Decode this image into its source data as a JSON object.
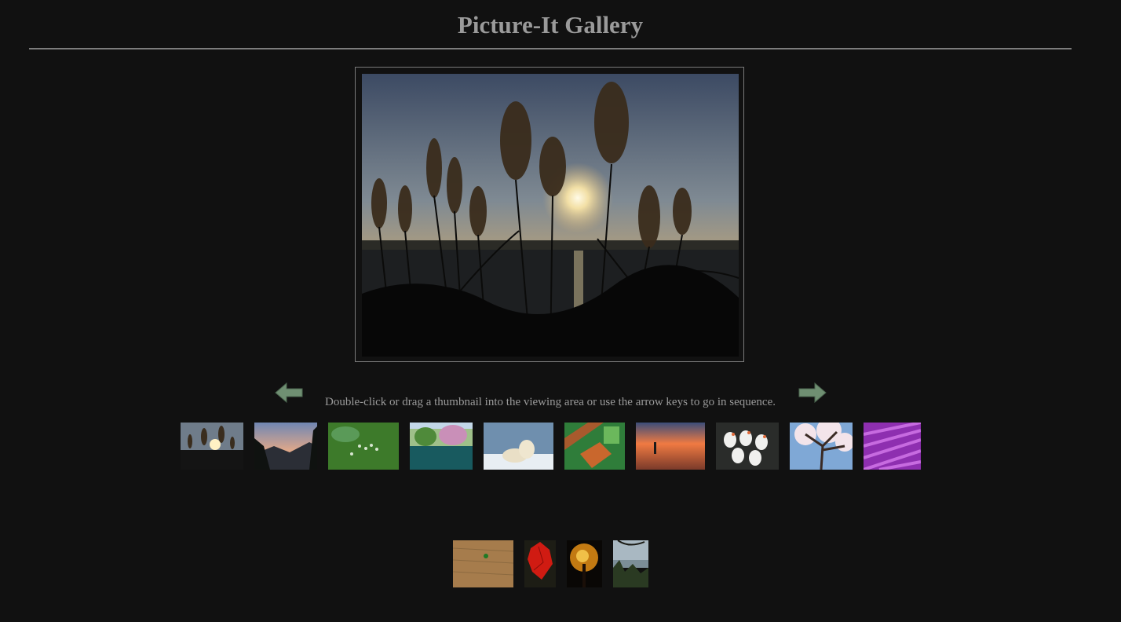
{
  "page": {
    "title": "Picture-It Gallery",
    "hint": "Double-click or drag a thumbnail into the viewing area or use the arrow keys to go in sequence."
  },
  "viewer": {
    "image": "pampas grass silhouette at sunset over lake"
  },
  "navigation": {
    "prev_icon": "left-arrow-icon",
    "next_icon": "right-arrow-icon",
    "arrow_color": "#6f8f72"
  },
  "thumbnails_row1": [
    {
      "name": "pampas-grass-sunset"
    },
    {
      "name": "mountain-dusk"
    },
    {
      "name": "green-pond-aerial"
    },
    {
      "name": "lake-reflection-trees"
    },
    {
      "name": "polar-bears-snow"
    },
    {
      "name": "aerial-fields"
    },
    {
      "name": "beach-sunset-person"
    },
    {
      "name": "white-geese"
    },
    {
      "name": "cherry-blossom-tree"
    },
    {
      "name": "lavender-field"
    }
  ],
  "thumbnails_row2": [
    {
      "name": "sand-plant"
    },
    {
      "name": "red-maple-leaves"
    },
    {
      "name": "autumn-tree-night"
    },
    {
      "name": "coastal-forest-view"
    }
  ]
}
